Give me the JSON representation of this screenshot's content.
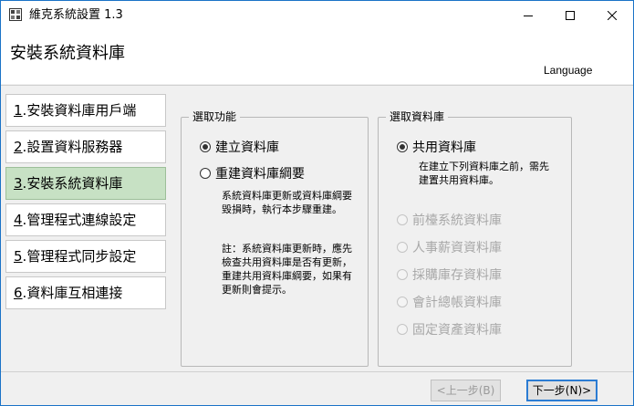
{
  "window": {
    "title": "維克系統設置 1.3"
  },
  "header": {
    "title": "安裝系統資料庫",
    "language_link": "Language"
  },
  "steps": [
    {
      "num": "1",
      "label": ".安裝資料庫用戶端"
    },
    {
      "num": "2",
      "label": ".設置資料服務器"
    },
    {
      "num": "3",
      "label": ".安裝系統資料庫"
    },
    {
      "num": "4",
      "label": ".管理程式連線設定"
    },
    {
      "num": "5",
      "label": ".管理程式同步設定"
    },
    {
      "num": "6",
      "label": ".資料庫互相連接"
    }
  ],
  "function_group": {
    "label": "選取功能",
    "options": [
      {
        "label": "建立資料庫",
        "checked": true
      },
      {
        "label": "重建資料庫綱要",
        "checked": false
      }
    ],
    "note1": "系統資料庫更新或資料庫綱要毀損時，執行本步驟重建。",
    "note2": "註：系統資料庫更新時，應先檢查共用資料庫是否有更新，重建共用資料庫綱要，如果有更新則會提示。"
  },
  "database_group": {
    "label": "選取資料庫",
    "shared": {
      "label": "共用資料庫",
      "checked": true
    },
    "shared_note": "在建立下列資料庫之前，需先建置共用資料庫。",
    "disabled_options": [
      "前檯系統資料庫",
      "人事薪資資料庫",
      "採購庫存資料庫",
      "會計總帳資料庫",
      "固定資產資料庫"
    ]
  },
  "footer": {
    "prev_label": "<上一步(B)",
    "next_label": "下一步(N)>"
  },
  "colors": {
    "active_step": "#c7e1c4",
    "accent_border": "#2b7cd3",
    "window_border": "#1a73c7"
  }
}
